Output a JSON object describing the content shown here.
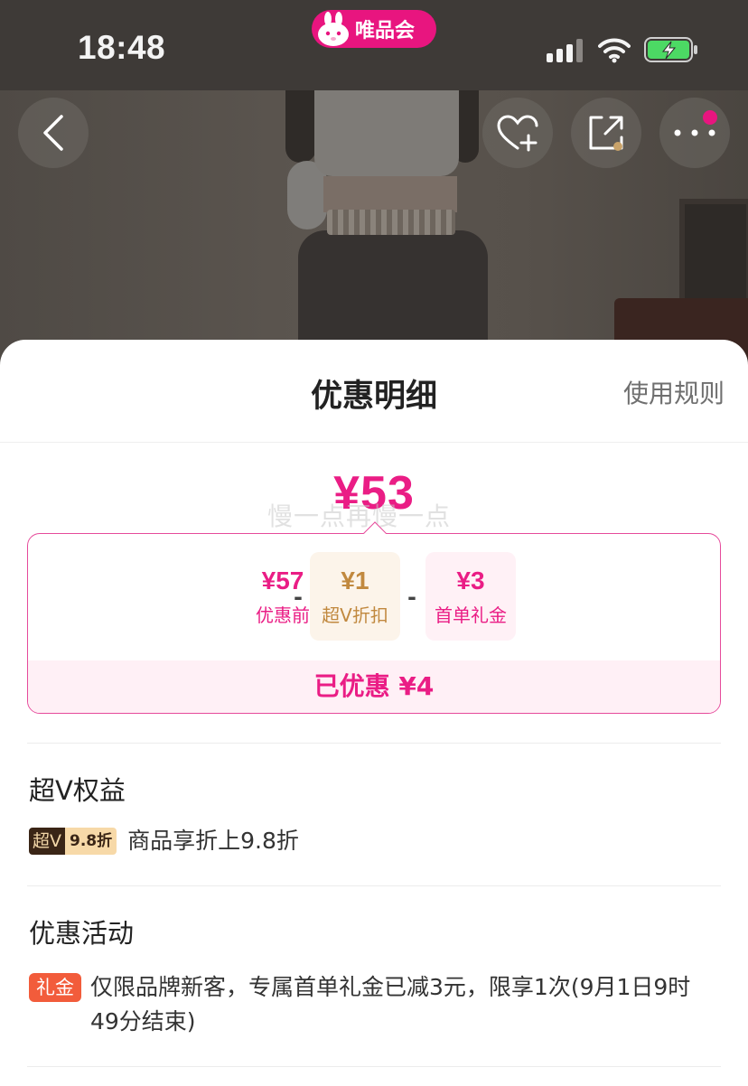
{
  "status_bar": {
    "time": "18:48",
    "app_badge": "唯品会"
  },
  "nav": {
    "back_icon": "chevron-left-icon",
    "favorite_icon": "heart-plus-icon",
    "share_icon": "share-icon",
    "more_icon": "more-dots-icon"
  },
  "sheet": {
    "title": "优惠明细",
    "rules_link": "使用规则",
    "final_price": "¥53",
    "watermark": "慢一点再慢一点",
    "breakdown": {
      "before": {
        "amount": "¥57",
        "label": "优惠前"
      },
      "vip": {
        "amount": "¥1",
        "label": "超V折扣"
      },
      "gift": {
        "amount": "¥3",
        "label": "首单礼金"
      },
      "minus": "-",
      "saved": "已优惠 ¥4"
    },
    "sections": [
      {
        "title": "超V权益",
        "badge_left": "超V",
        "badge_right": "9.8折",
        "text": "商品享折上9.8折"
      },
      {
        "title": "优惠活动",
        "badge": "礼金",
        "text": "仅限品牌新客，专属首单礼金已减3元，限享1次(9月1日9时49分结束)"
      }
    ]
  },
  "colors": {
    "brand_pink": "#ea1d85",
    "vip_gold": "#c1893f",
    "gift_orange": "#f25c3b"
  }
}
